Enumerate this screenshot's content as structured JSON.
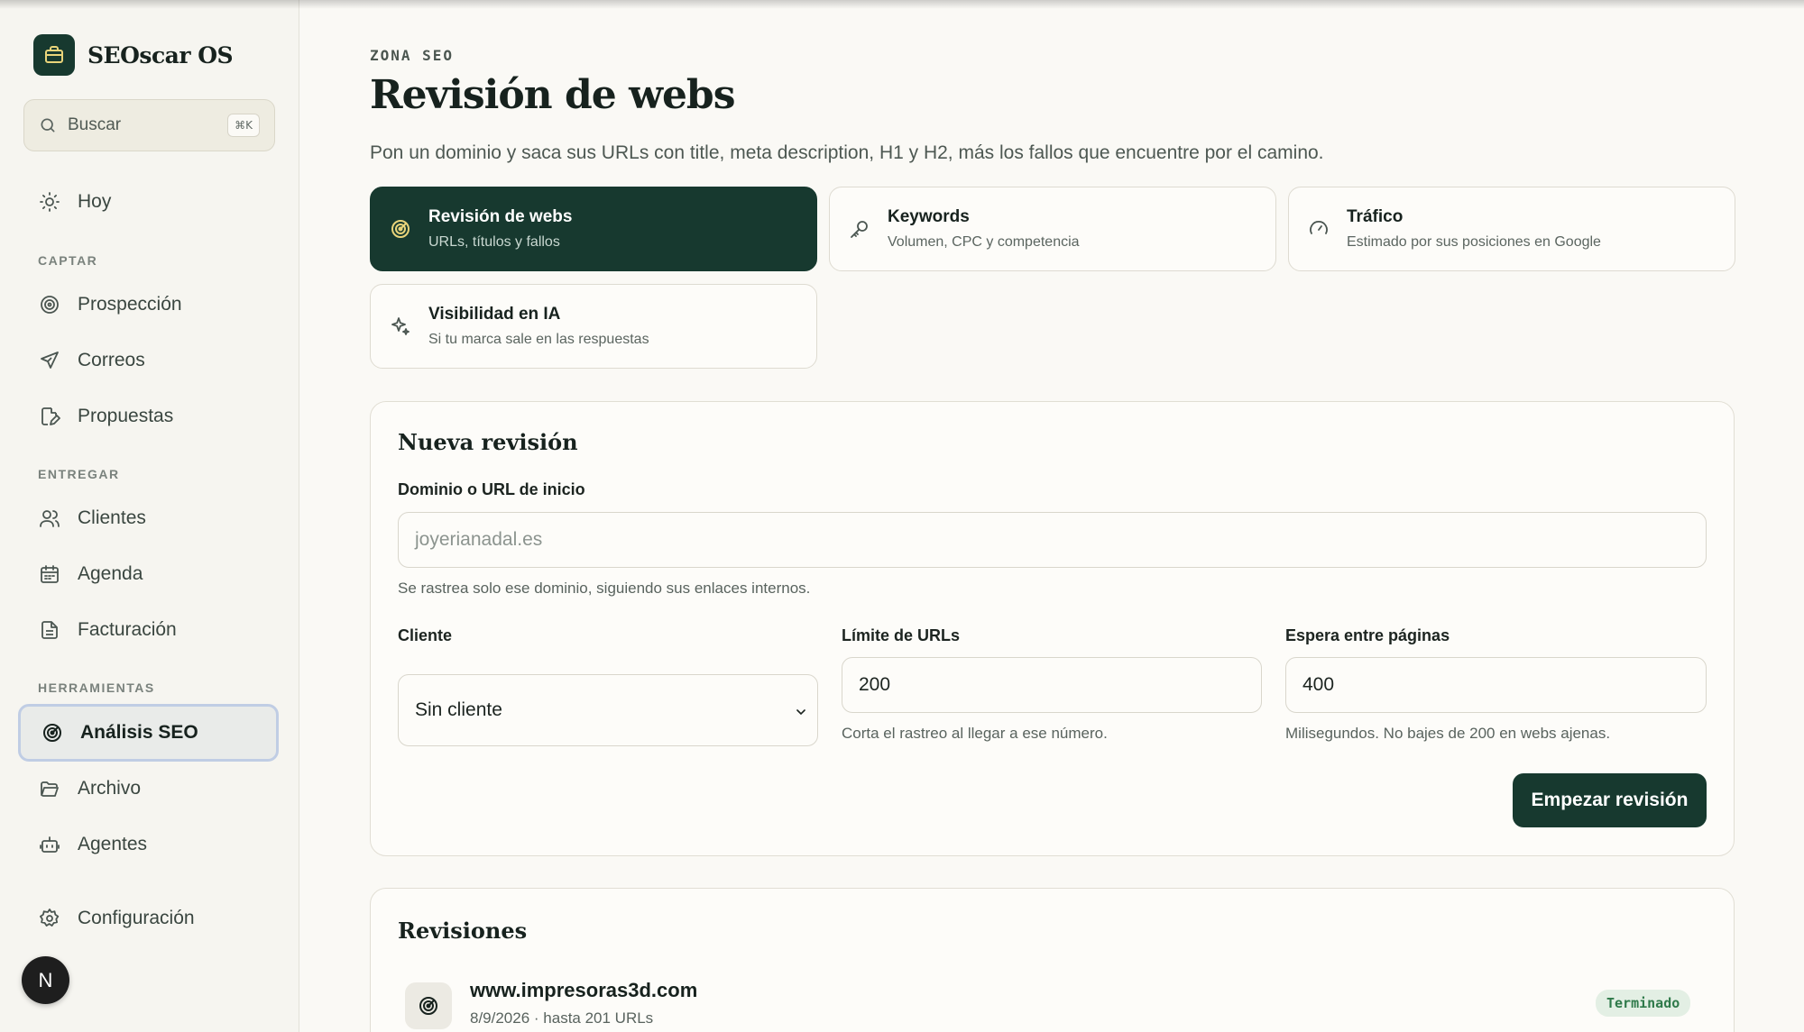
{
  "app": {
    "name": "SEOscar OS"
  },
  "search": {
    "label": "Buscar",
    "shortcut": "⌘K"
  },
  "nav": {
    "today": "Hoy",
    "sections": {
      "captar": "CAPTAR",
      "entregar": "ENTREGAR",
      "herramientas": "HERRAMIENTAS"
    },
    "prospeccion": "Prospección",
    "correos": "Correos",
    "propuestas": "Propuestas",
    "clientes": "Clientes",
    "agenda": "Agenda",
    "facturacion": "Facturación",
    "analisis_seo": "Análisis SEO",
    "archivo": "Archivo",
    "agentes": "Agentes",
    "configuracion": "Configuración",
    "active": "Análisis SEO"
  },
  "user": {
    "initial": "N"
  },
  "header": {
    "eyebrow": "ZONA SEO",
    "title": "Revisión de webs",
    "description": "Pon un dominio y saca sus URLs con title, meta description, H1 y H2, más los fallos que encuentre por el camino."
  },
  "tools": [
    {
      "title": "Revisión de webs",
      "subtitle": "URLs, títulos y fallos",
      "icon": "target-icon",
      "active": true
    },
    {
      "title": "Keywords",
      "subtitle": "Volumen, CPC y competencia",
      "icon": "key-icon",
      "active": false
    },
    {
      "title": "Tráfico",
      "subtitle": "Estimado por sus posiciones en Google",
      "icon": "gauge-icon",
      "active": false
    },
    {
      "title": "Visibilidad en IA",
      "subtitle": "Si tu marca sale en las respuestas",
      "icon": "sparkle-icon",
      "active": false
    }
  ],
  "form": {
    "title": "Nueva revisión",
    "domain_label": "Dominio o URL de inicio",
    "domain_placeholder": "joyerianadal.es",
    "domain_help": "Se rastrea solo ese dominio, siguiendo sus enlaces internos.",
    "client_label": "Cliente",
    "client_value": "Sin cliente",
    "limit_label": "Límite de URLs",
    "limit_value": "200",
    "limit_help": "Corta el rastreo al llegar a ese número.",
    "wait_label": "Espera entre páginas",
    "wait_value": "400",
    "wait_help": "Milisegundos. No bajes de 200 en webs ajenas.",
    "submit_label": "Empezar revisión"
  },
  "revisions": {
    "title": "Revisiones",
    "items": [
      {
        "domain": "www.impresoras3d.com",
        "meta": "8/9/2026 · hasta 201 URLs",
        "status": "Terminado"
      }
    ]
  },
  "colors": {
    "accent": "#17392f",
    "background": "#faf9f5",
    "status_done": "#2f7a4a"
  }
}
